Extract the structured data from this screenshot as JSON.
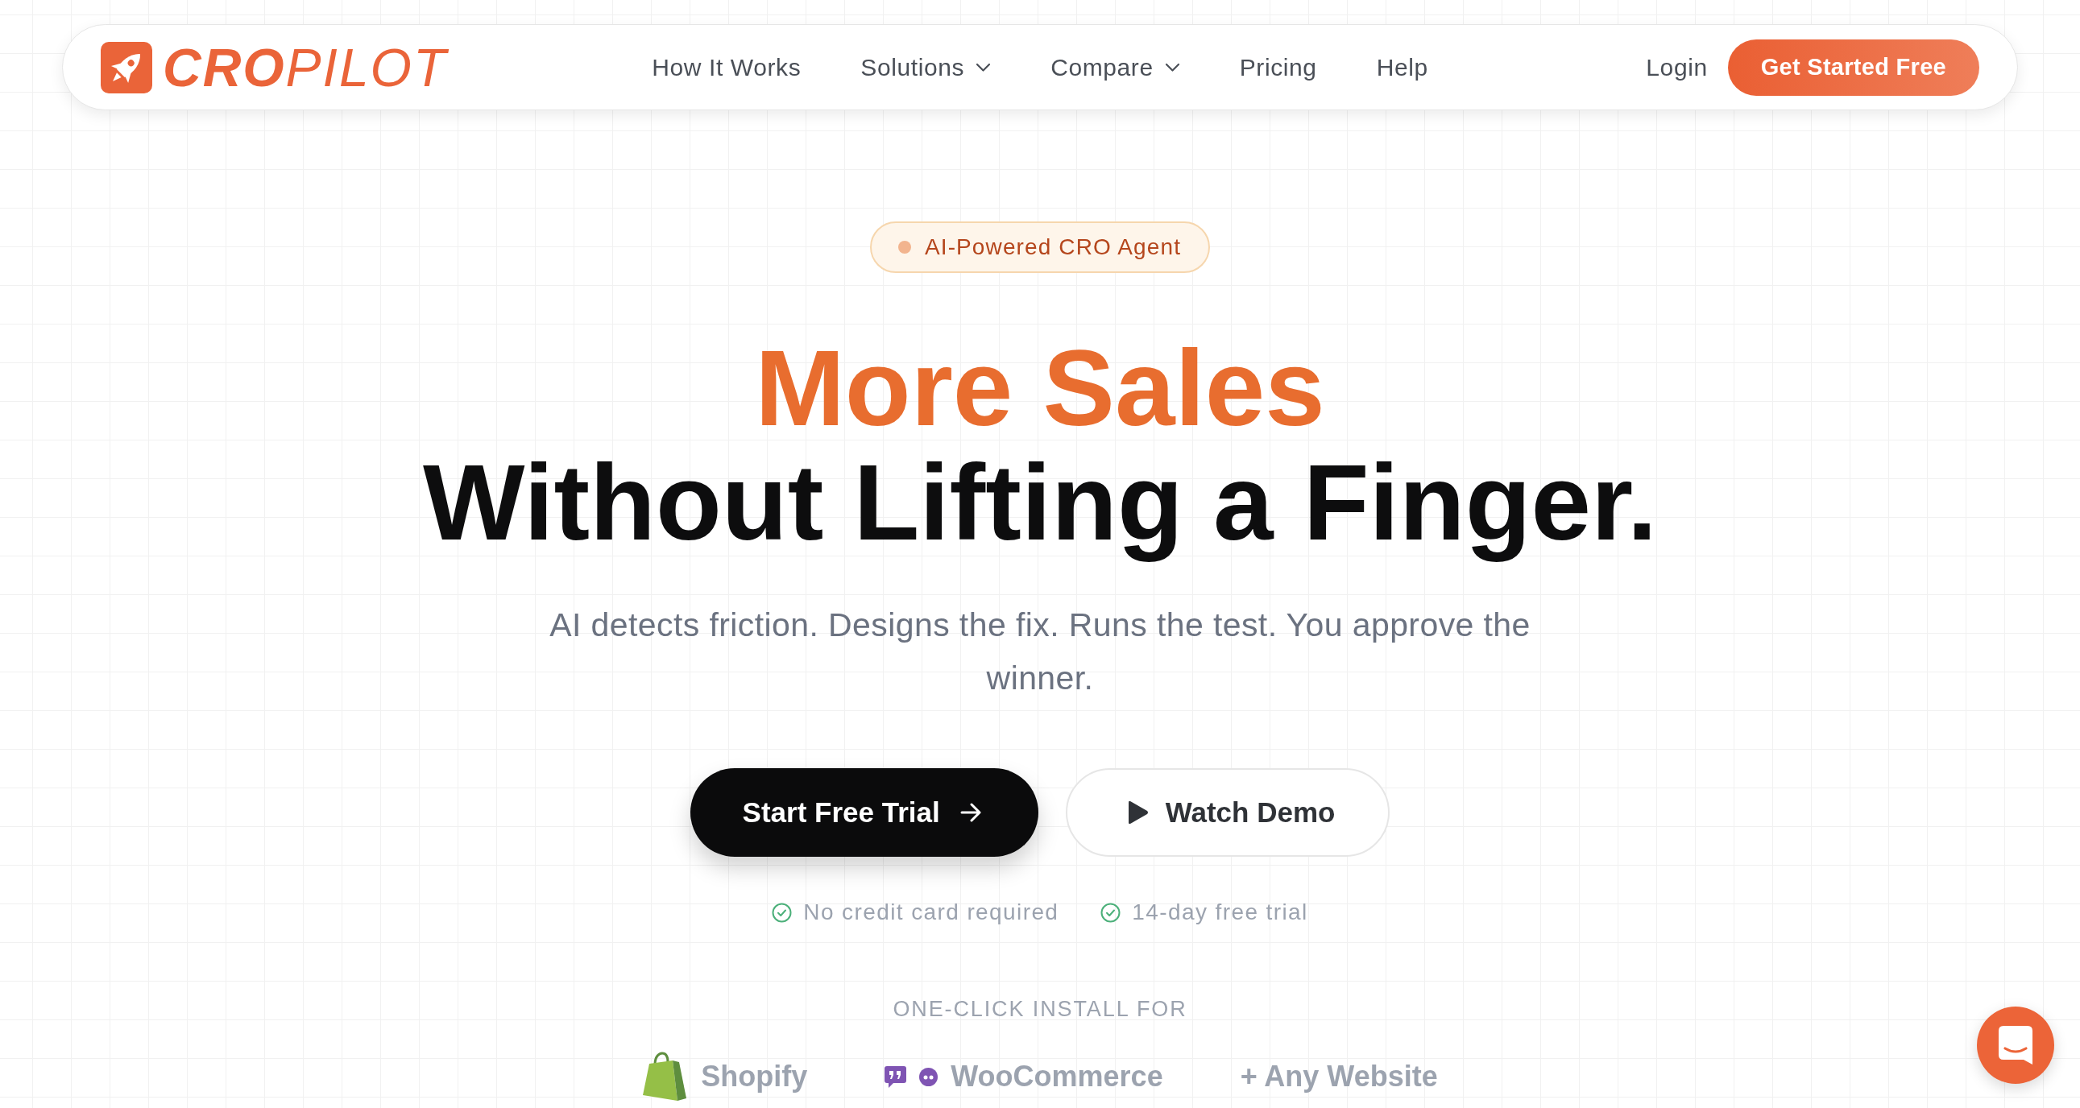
{
  "nav": {
    "logo": "**CRO**PILOT",
    "links": [
      {
        "label": "How It Works",
        "dropdown": false
      },
      {
        "label": "Solutions",
        "dropdown": true
      },
      {
        "label": "Compare",
        "dropdown": true
      },
      {
        "label": "Pricing",
        "dropdown": false
      },
      {
        "label": "Help",
        "dropdown": false
      }
    ],
    "login": "Login",
    "cta": "Get Started Free"
  },
  "hero": {
    "badge": "AI-Powered CRO Agent",
    "headline": [
      {
        "text": "More Sales",
        "accent": true
      },
      {
        "text": "Without Lifting a Finger.",
        "accent": false
      }
    ],
    "subtitle": "AI detects friction. Designs the fix. Runs the test. You approve the winner.",
    "buttons": [
      {
        "label": "Start Free Trial",
        "kind": "primary"
      },
      {
        "label": "Watch Demo",
        "kind": "secondary"
      }
    ],
    "perks": [
      "No credit card required",
      "14-day free trial"
    ],
    "install_label": "ONE-CLICK INSTALL FOR",
    "platforms": [
      {
        "name": "Shopify",
        "kind": "shopify"
      },
      {
        "name": "WooCommerce",
        "kind": "woocommerce"
      },
      {
        "name": "+ Any Website",
        "kind": "other"
      }
    ]
  }
}
